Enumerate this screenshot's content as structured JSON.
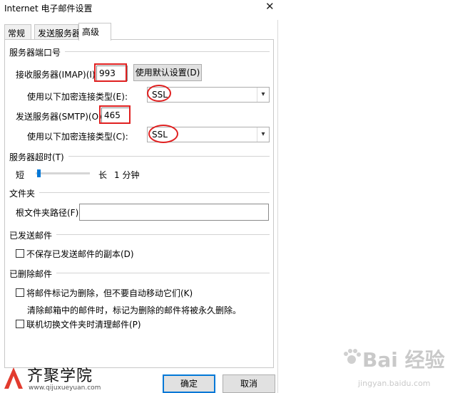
{
  "window": {
    "title": "Internet 电子邮件设置",
    "close_glyph": "✕"
  },
  "tabs": [
    {
      "label": "常规"
    },
    {
      "label": "发送服务器"
    },
    {
      "label": "高级"
    }
  ],
  "server_ports": {
    "section_title": "服务器端口号",
    "incoming_label": "接收服务器(IMAP)(I):",
    "incoming_value": "993",
    "use_default_button": "使用默认设置(D)",
    "incoming_encryption_label": "使用以下加密连接类型(E):",
    "incoming_encryption_value": "SSL",
    "outgoing_label": "发送服务器(SMTP)(O):",
    "outgoing_value": "465",
    "outgoing_encryption_label": "使用以下加密连接类型(C):",
    "outgoing_encryption_value": "SSL"
  },
  "server_timeout": {
    "section_title": "服务器超时(T)",
    "short_label": "短",
    "long_label": "长",
    "value_label": "1 分钟",
    "slider_fraction": 0.03
  },
  "folders": {
    "section_title": "文件夹",
    "root_path_label": "根文件夹路径(F):",
    "root_path_value": ""
  },
  "sent_items": {
    "section_title": "已发送邮件",
    "dont_save_label": "不保存已发送邮件的副本(D)"
  },
  "deleted_items": {
    "section_title": "已删除邮件",
    "mark_delete_label": "将邮件标记为删除，但不要自动移动它们(K)",
    "mark_delete_note": "清除邮箱中的邮件时，标记为删除的邮件将被永久删除。",
    "purge_label": "联机切换文件夹时清理邮件(P)"
  },
  "footer": {
    "ok_label": "确定",
    "cancel_label": "取消"
  },
  "logo": {
    "brand": "齐聚学院",
    "url": "www.qijuxueyuan.com"
  },
  "watermark": {
    "text": "Bai 经验",
    "url": "jingyan.baidu.com"
  },
  "colors": {
    "accent": "#0078d7",
    "annotation_red": "#e02020"
  }
}
